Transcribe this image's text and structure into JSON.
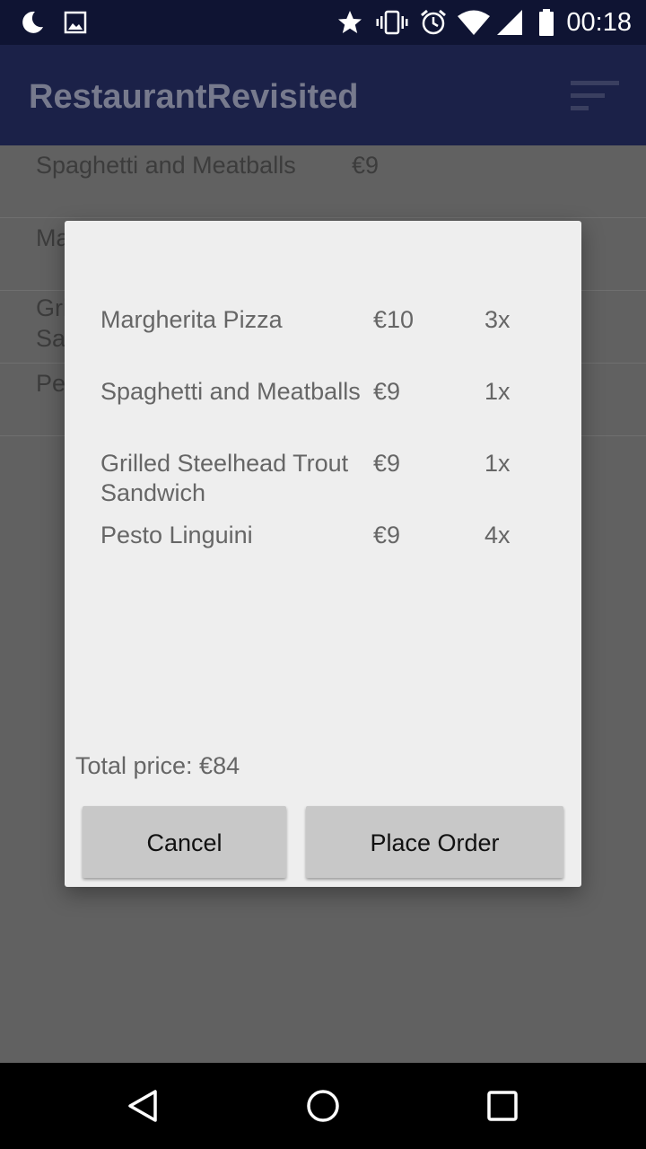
{
  "status_bar": {
    "time": "00:18",
    "icons": [
      "moon-icon",
      "image-icon",
      "star-icon",
      "vibrate-icon",
      "alarm-icon",
      "wifi-icon",
      "signal-icon",
      "battery-icon"
    ]
  },
  "app_bar": {
    "title": "RestaurantRevisited",
    "action_icon": "sort-icon"
  },
  "menu_list": {
    "items": [
      {
        "name": "Spaghetti and Meatballs",
        "price": "€9"
      },
      {
        "name": "Ma",
        "price": ""
      },
      {
        "name": "Gri\nSa",
        "price": ""
      },
      {
        "name": "Pe",
        "price": ""
      }
    ]
  },
  "dialog": {
    "order_items": [
      {
        "name": "Margherita Pizza",
        "price": "€10",
        "quantity": "3x"
      },
      {
        "name": "Spaghetti and Meatballs",
        "price": "€9",
        "quantity": "1x"
      },
      {
        "name": "Grilled Steelhead Trout Sandwich",
        "price": "€9",
        "quantity": "1x"
      },
      {
        "name": "Pesto Linguini",
        "price": "€9",
        "quantity": "4x"
      }
    ],
    "total_label": "Total price: €84",
    "cancel_label": "Cancel",
    "place_order_label": "Place Order"
  },
  "nav_bar": {
    "icons": [
      "back-icon",
      "home-icon",
      "recents-icon"
    ]
  },
  "colors": {
    "status_bar": "#0f1433",
    "app_bar": "#1b2148",
    "scrim": "#616161",
    "dialog_bg": "#eeeeee",
    "button_bg": "#c8c8c8"
  }
}
